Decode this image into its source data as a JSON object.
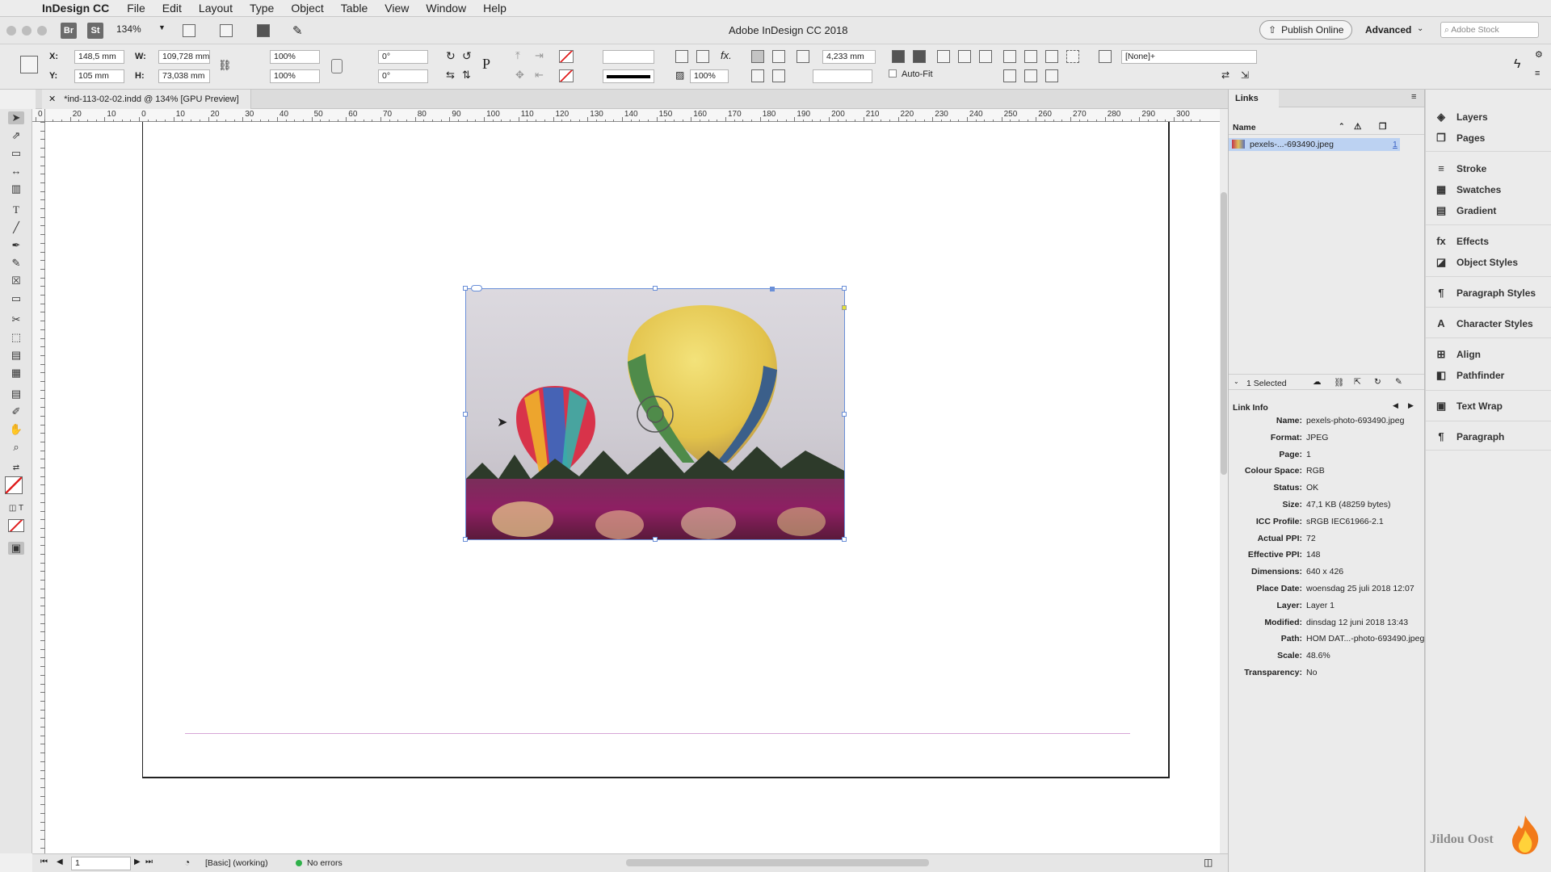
{
  "menubar": {
    "app_name": "InDesign CC",
    "items": [
      "File",
      "Edit",
      "Layout",
      "Type",
      "Object",
      "Table",
      "View",
      "Window",
      "Help"
    ]
  },
  "titlebar": {
    "zoom": "134%",
    "title": "Adobe InDesign CC 2018",
    "bridge_label": "Br",
    "stock_label": "St",
    "publish_label": "Publish Online",
    "workspace": "Advanced",
    "search_placeholder": "Adobe Stock"
  },
  "control": {
    "x_label": "X:",
    "x": "148,5 mm",
    "y_label": "Y:",
    "y": "105 mm",
    "w_label": "W:",
    "w": "109,728 mm",
    "h_label": "H:",
    "h": "73,038 mm",
    "scale_x": "100%",
    "scale_y": "100%",
    "rotate": "0°",
    "shear": "0°",
    "stroke_weight": "4,233 mm",
    "opacity": "100%",
    "autofit": "Auto-Fit",
    "style": "[None]+"
  },
  "document_tab": {
    "title": "*ind-113-02-02.indd @ 134% [GPU Preview]"
  },
  "ruler": {
    "h_labels": [
      "0",
      "20",
      "10",
      "0",
      "10",
      "20",
      "30",
      "40",
      "50",
      "60",
      "70",
      "80",
      "90",
      "100",
      "110",
      "120",
      "130",
      "140",
      "150",
      "160",
      "170",
      "180",
      "190",
      "200",
      "210",
      "220",
      "230",
      "240",
      "250",
      "260",
      "270",
      "280",
      "290",
      "300"
    ]
  },
  "status": {
    "page": "1",
    "preflight_profile": "[Basic] (working)",
    "errors": "No errors"
  },
  "links": {
    "title": "Links",
    "col_name": "Name",
    "file": "pexels-...-693490.jpeg",
    "file_page": "1",
    "selected": "1 Selected",
    "info_title": "Link Info",
    "info": [
      {
        "k": "Name:",
        "v": "pexels-photo-693490.jpeg"
      },
      {
        "k": "Format:",
        "v": "JPEG"
      },
      {
        "k": "Page:",
        "v": "1"
      },
      {
        "k": "Colour Space:",
        "v": "RGB"
      },
      {
        "k": "Status:",
        "v": "OK"
      },
      {
        "k": "Size:",
        "v": "47,1 KB (48259 bytes)"
      },
      {
        "k": "ICC Profile:",
        "v": "sRGB IEC61966-2.1"
      },
      {
        "k": "Actual PPI:",
        "v": "72"
      },
      {
        "k": "Effective PPI:",
        "v": "148"
      },
      {
        "k": "Dimensions:",
        "v": "640 x 426"
      },
      {
        "k": "Place Date:",
        "v": "woensdag 25 juli 2018 12:07"
      },
      {
        "k": "Layer:",
        "v": "Layer 1"
      },
      {
        "k": "Modified:",
        "v": "dinsdag 12 juni 2018 13:43"
      },
      {
        "k": "Path:",
        "v": "HOM DAT...-photo-693490.jpeg"
      },
      {
        "k": "Scale:",
        "v": "48.6%"
      },
      {
        "k": "Transparency:",
        "v": "No"
      }
    ]
  },
  "panels": {
    "items": [
      {
        "label": "Layers",
        "icon": "layers-icon",
        "glyph": "◈"
      },
      {
        "label": "Pages",
        "icon": "pages-icon",
        "glyph": "❐"
      },
      {
        "label": "Stroke",
        "icon": "stroke-icon",
        "glyph": "≡"
      },
      {
        "label": "Swatches",
        "icon": "swatches-icon",
        "glyph": "▦"
      },
      {
        "label": "Gradient",
        "icon": "gradient-icon",
        "glyph": "▤"
      },
      {
        "label": "Effects",
        "icon": "effects-icon",
        "glyph": "fx"
      },
      {
        "label": "Object Styles",
        "icon": "object-styles-icon",
        "glyph": "◪"
      },
      {
        "label": "Paragraph Styles",
        "icon": "paragraph-styles-icon",
        "glyph": "¶"
      },
      {
        "label": "Character Styles",
        "icon": "character-styles-icon",
        "glyph": "A"
      },
      {
        "label": "Align",
        "icon": "align-icon",
        "glyph": "⊞"
      },
      {
        "label": "Pathfinder",
        "icon": "pathfinder-icon",
        "glyph": "◧"
      },
      {
        "label": "Text Wrap",
        "icon": "text-wrap-icon",
        "glyph": "▣"
      },
      {
        "label": "Paragraph",
        "icon": "paragraph-icon",
        "glyph": "¶"
      }
    ]
  },
  "watermark": {
    "text": "Jildou Oost"
  },
  "colors": {
    "accent": "#6a8fd8",
    "selection": "#bcd2f2",
    "guide": "#d7a6d7"
  }
}
